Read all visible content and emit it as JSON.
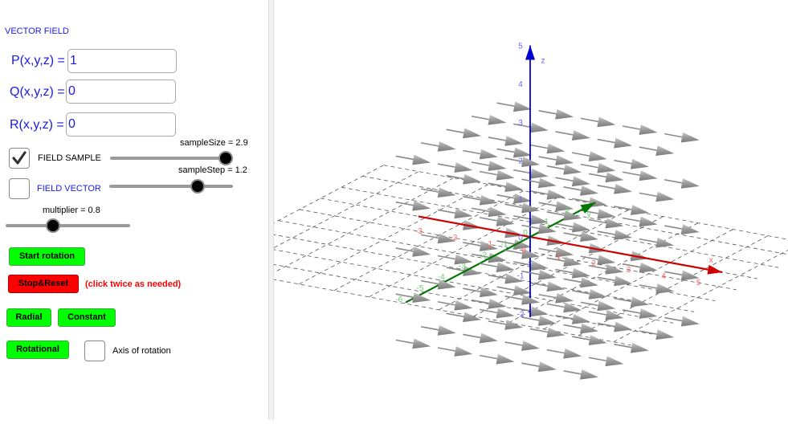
{
  "panel": {
    "title": "VECTOR FIELD",
    "fields": [
      {
        "label": "P(x,y,z) =",
        "value": "1"
      },
      {
        "label": "Q(x,y,z) =",
        "value": "0"
      },
      {
        "label": "R(x,y,z) =",
        "value": "0"
      }
    ],
    "field_sample": {
      "label": "FIELD SAMPLE",
      "checked": true
    },
    "field_vector": {
      "label": "FIELD VECTOR",
      "checked": false
    },
    "sliders": {
      "sampleSize": {
        "label": "sampleSize = 2.9",
        "value": 2.9,
        "min": 0,
        "max": 3,
        "fraction": 0.96
      },
      "sampleStep": {
        "label": "sampleStep = 1.2",
        "value": 1.2,
        "min": 0,
        "max": 2,
        "fraction": 0.7
      },
      "multiplier": {
        "label": "multiplier = 0.8",
        "value": 0.8,
        "fraction": 0.37
      }
    },
    "buttons": {
      "start_rotation": "Start rotation",
      "stop_reset": "Stop&Reset",
      "stop_note": "(click twice as needed)",
      "radial": "Radial",
      "constant": "Constant",
      "rotational": "Rotational"
    },
    "axis_of_rotation": {
      "label": "Axis of rotation",
      "checked": false
    }
  },
  "view3d": {
    "axes": {
      "x": {
        "name": "x",
        "color": "#cc0000",
        "label_color": "#ff6666",
        "ticks": [
          "-3",
          "-2",
          "-1",
          "0",
          "1",
          "2",
          "3",
          "4",
          "5"
        ],
        "tick_values": [
          -3,
          -2,
          -1,
          0,
          1,
          2,
          3,
          4,
          5
        ],
        "range": [
          -3.2,
          5.5
        ]
      },
      "y": {
        "name": "y",
        "color": "#007700",
        "label_color": "#66cc66",
        "ticks": [
          "-6",
          "-5",
          "-4",
          "-3",
          "-2",
          "-1",
          "0",
          "1",
          "2"
        ],
        "tick_values": [
          -6,
          -5,
          -4,
          -3,
          -2,
          -1,
          0,
          1,
          2
        ],
        "range": [
          -5.9,
          3.1
        ]
      },
      "z": {
        "name": "z",
        "color": "#0000cc",
        "label_color": "#6666ff",
        "ticks": [
          "5",
          "4",
          "3",
          "2",
          "1",
          "0",
          "-1",
          "-2"
        ],
        "tick_values": [
          5,
          4,
          3,
          2,
          1,
          0,
          -1,
          -2
        ],
        "range": [
          -2.1,
          5
        ]
      }
    },
    "field": {
      "P": 1,
      "Q": 0,
      "R": 0,
      "arrow_color": "#a0a0a0"
    },
    "sample": {
      "size": 2.9,
      "step": 1.2,
      "multiplier": 0.8
    }
  }
}
